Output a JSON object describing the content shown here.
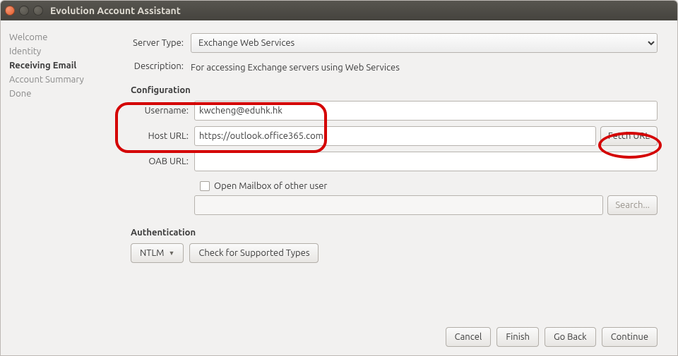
{
  "window": {
    "title": "Evolution Account Assistant"
  },
  "sidebar": {
    "items": [
      {
        "label": "Welcome",
        "active": false
      },
      {
        "label": "Identity",
        "active": false
      },
      {
        "label": "Receiving Email",
        "active": true
      },
      {
        "label": "Account Summary",
        "active": false
      },
      {
        "label": "Done",
        "active": false
      }
    ]
  },
  "server_type": {
    "label": "Server Type:",
    "value": "Exchange Web Services"
  },
  "description": {
    "label": "Description:",
    "value": "For accessing Exchange servers using Web Services"
  },
  "config": {
    "heading": "Configuration",
    "username_label": "Username:",
    "username_value": "kwcheng@eduhk.hk",
    "hosturl_label": "Host URL:",
    "hosturl_value": "https://outlook.office365.com",
    "fetch_label": "Fetch URL",
    "oaburl_label": "OAB URL:",
    "oaburl_value": "",
    "open_mailbox_label": "Open Mailbox of other user",
    "other_user_value": "",
    "search_label": "Search..."
  },
  "auth": {
    "heading": "Authentication",
    "method": "NTLM",
    "check_label": "Check for Supported Types"
  },
  "footer": {
    "cancel": "Cancel",
    "finish": "Finish",
    "goback": "Go Back",
    "continue": "Continue"
  }
}
